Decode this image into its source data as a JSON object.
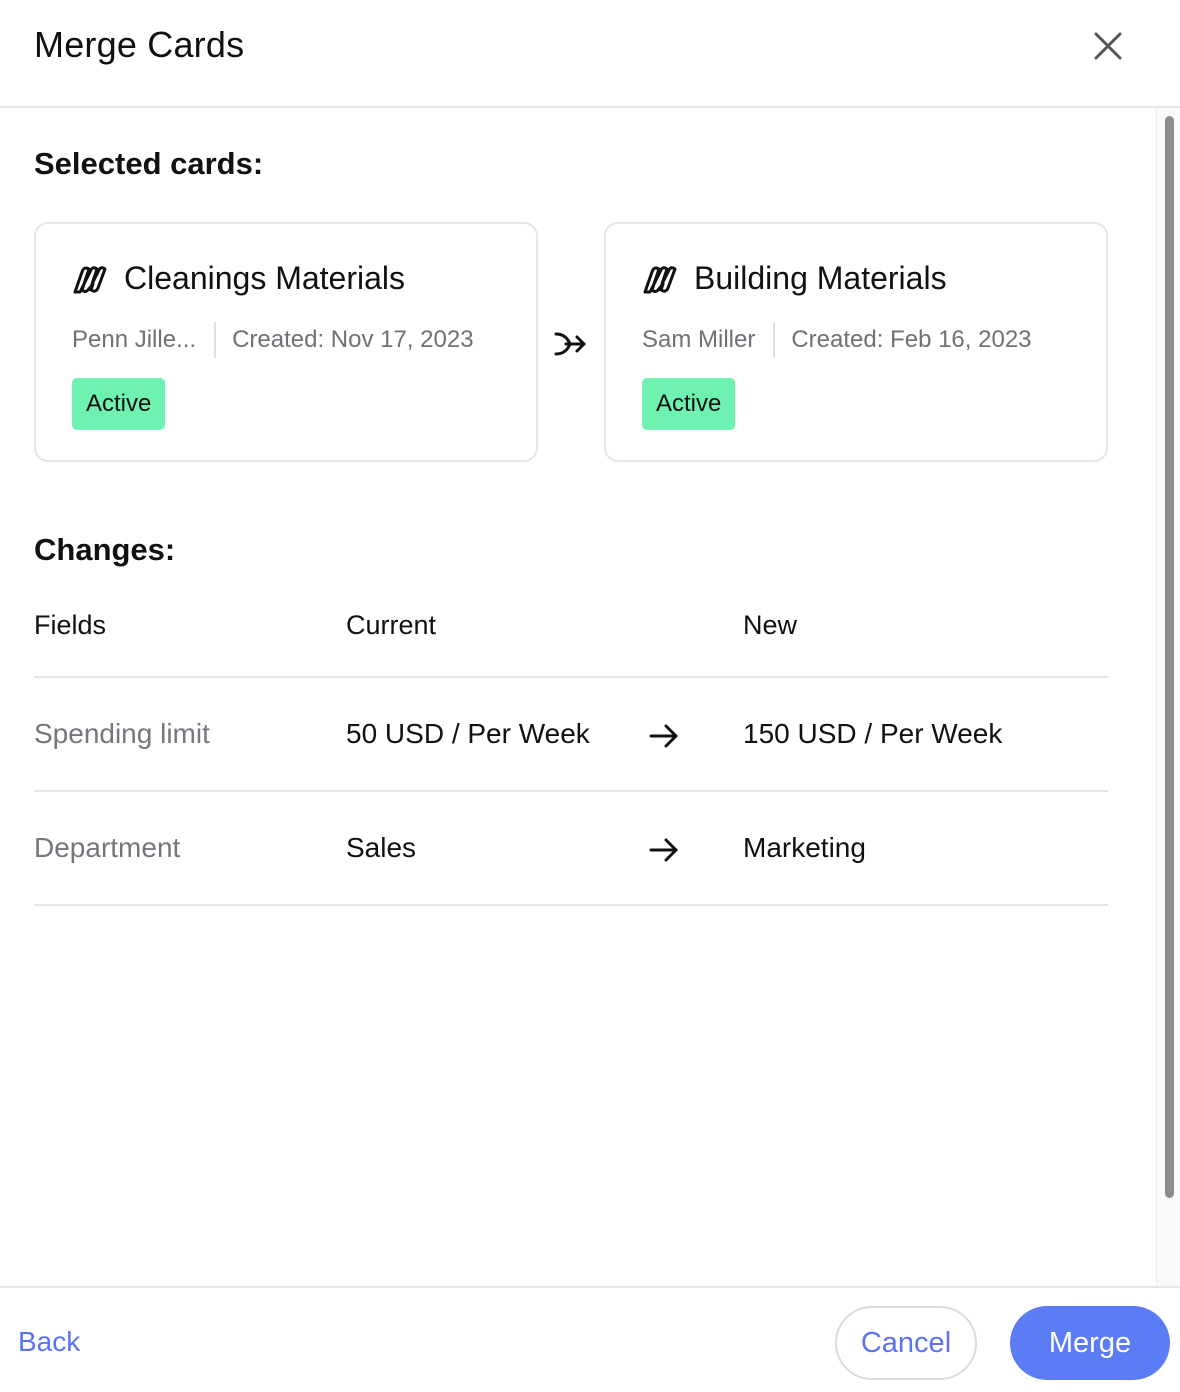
{
  "dialog": {
    "title": "Merge Cards",
    "close_icon": "close-icon"
  },
  "selected": {
    "heading": "Selected cards:",
    "merge_direction_icon": "merge-arrow-icon",
    "cards": [
      {
        "name": "Cleanings Materials",
        "icon": "card-brand-icon",
        "owner": "Penn Jille...",
        "created": "Created: Nov 17, 2023",
        "status": "Active"
      },
      {
        "name": "Building Materials",
        "icon": "card-brand-icon",
        "owner": "Sam Miller",
        "created": "Created: Feb 16, 2023",
        "status": "Active"
      }
    ]
  },
  "changes": {
    "heading": "Changes:",
    "columns": [
      "Fields",
      "Current",
      "New"
    ],
    "rows": [
      {
        "field": "Spending limit",
        "current": "50 USD / Per Week",
        "new": "150 USD / Per Week",
        "arrow_icon": "arrow-right-icon"
      },
      {
        "field": "Department",
        "current": "Sales",
        "new": "Marketing",
        "arrow_icon": "arrow-right-icon"
      }
    ]
  },
  "footer": {
    "back_label": "Back",
    "cancel_label": "Cancel",
    "merge_label": "Merge"
  },
  "colors": {
    "accent": "#5c7cf6",
    "link": "#5b73f0",
    "active_badge": "#6ff2b1",
    "border": "#e3e5e8",
    "muted_text": "#6e7175"
  }
}
